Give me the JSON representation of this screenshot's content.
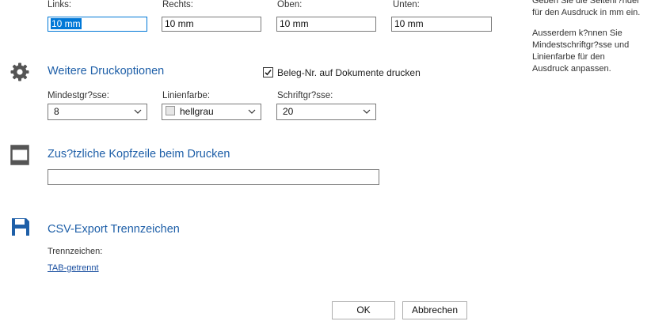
{
  "margins": {
    "left": {
      "label": "Links:",
      "value": "10 mm"
    },
    "right": {
      "label": "Rechts:",
      "value": "10 mm"
    },
    "top": {
      "label": "Oben:",
      "value": "10 mm"
    },
    "bottom": {
      "label": "Unten:",
      "value": "10 mm"
    }
  },
  "side_text": {
    "line1": "Geben Sie die Seitenr?nder",
    "line2": "für den Ausdruck in mm ein.",
    "line3": "Ausserdem k?nnen Sie",
    "line4": "Mindestschriftgr?sse und",
    "line5": "Linienfarbe für den",
    "line6": "Ausdruck anpassen."
  },
  "print_options": {
    "heading": "Weitere Druckoptionen",
    "checkbox_label": "Beleg-Nr. auf Dokumente drucken",
    "checkbox_checked": true,
    "min_size": {
      "label": "Mindestgr?sse:",
      "value": "8"
    },
    "line_color": {
      "label": "Linienfarbe:",
      "value": "hellgrau",
      "swatch": "#e6e6e6"
    },
    "font_size": {
      "label": "Schriftgr?sse:",
      "value": "20"
    }
  },
  "header_line": {
    "heading": "Zus?tzliche Kopfzeile beim Drucken",
    "value": ""
  },
  "csv": {
    "heading": "CSV-Export Trennzeichen",
    "label": "Trennzeichen:",
    "link": "TAB-getrennt"
  },
  "buttons": {
    "ok": "OK",
    "cancel": "Abbrechen"
  },
  "colors": {
    "accent": "#1e5fa8",
    "icon_gray": "#555555",
    "focus": "#0078d7"
  }
}
